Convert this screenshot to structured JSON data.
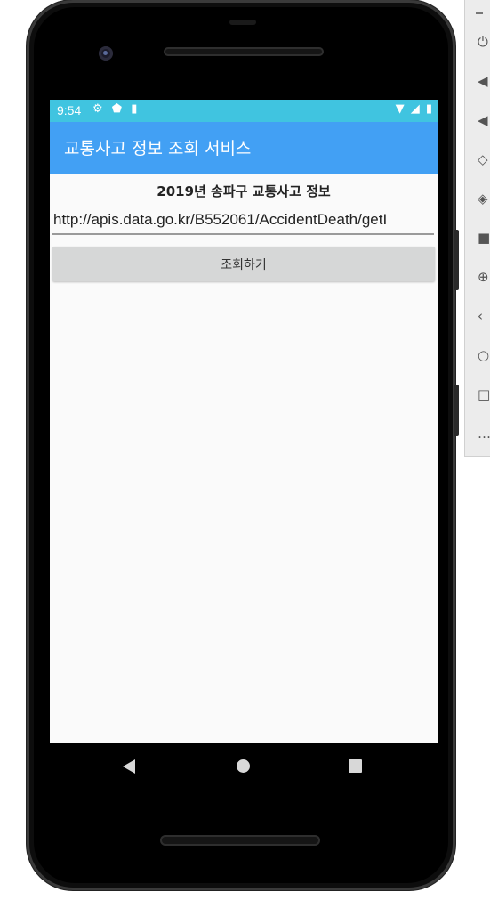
{
  "status_bar": {
    "time": "9:54",
    "left_icons": [
      "gear-icon",
      "shield-icon",
      "sd-card-icon"
    ],
    "right_icons": [
      "wifi-icon",
      "signal-icon",
      "battery-icon"
    ],
    "color": "#40c4e0"
  },
  "app_bar": {
    "title": "교통사고 정보 조회 서비스",
    "color": "#42a0f4"
  },
  "main": {
    "heading": "2019년 송파구 교통사고 정보",
    "url_value": "http://apis.data.go.kr/B552061/AccidentDeath/getI",
    "query_button_label": "조회하기"
  },
  "nav_bar": {
    "icons": [
      "back-icon",
      "home-icon",
      "recents-icon"
    ]
  },
  "side_toolbar": {
    "icons": [
      "power-icon",
      "volume-up-icon",
      "volume-down-icon",
      "rotate-left-icon",
      "rotate-right-icon",
      "camera-icon",
      "zoom-icon",
      "back-icon",
      "home-icon",
      "overview-icon",
      "more-icon"
    ]
  }
}
